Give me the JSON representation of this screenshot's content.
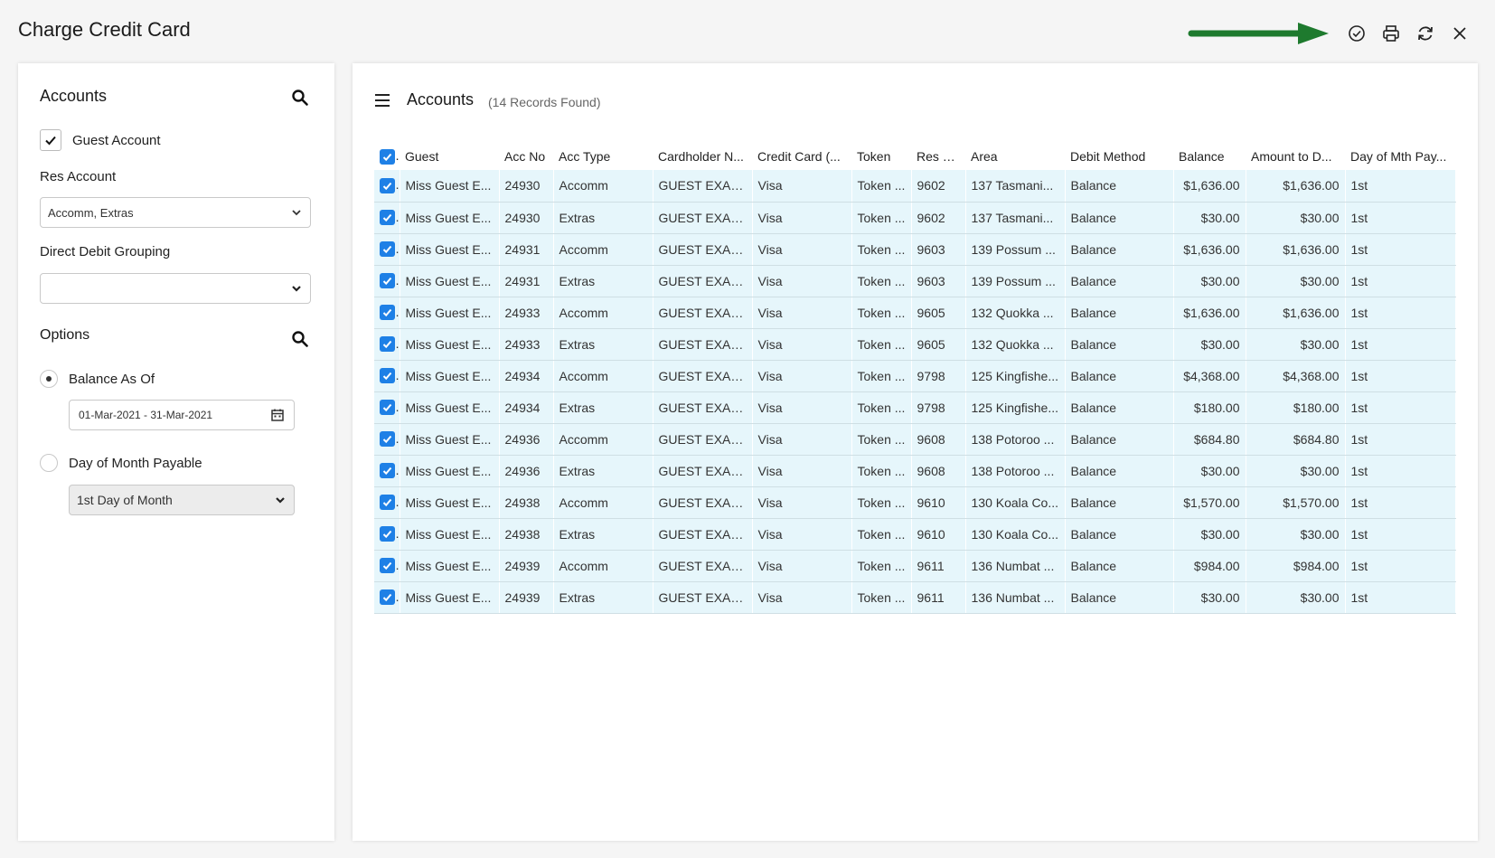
{
  "window": {
    "title": "Charge Credit Card"
  },
  "toolbar": {
    "icons": [
      "check-circle-icon",
      "print-icon",
      "refresh-icon",
      "close-icon"
    ],
    "arrow_color": "#1e7a2e"
  },
  "left": {
    "accounts_heading": "Accounts",
    "guest_account_label": "Guest Account",
    "guest_account_checked": true,
    "res_account_label": "Res Account",
    "res_account_value": "Accomm, Extras",
    "direct_debit_label": "Direct Debit Grouping",
    "direct_debit_value": "",
    "options_heading": "Options",
    "balance_as_of_label": "Balance As Of",
    "balance_as_of_selected": true,
    "date_range": "01-Mar-2021 - 31-Mar-2021",
    "day_of_month_label": "Day of Month Payable",
    "day_of_month_value": "1st Day of Month"
  },
  "grid": {
    "title": "Accounts",
    "records_text": "(14 Records Found)",
    "columns": [
      "Guest",
      "Acc No",
      "Acc Type",
      "Cardholder N...",
      "Credit Card (...",
      "Token",
      "Res N...",
      "Area",
      "Debit Method",
      "Balance",
      "Amount to D...",
      "Day of Mth Pay..."
    ],
    "rows": [
      [
        "Miss Guest E...",
        "24930",
        "Accomm",
        "GUEST EXAM...",
        "Visa",
        "Token ...",
        "9602",
        "137 Tasmani...",
        "Balance",
        "$1,636.00",
        "$1,636.00",
        "1st"
      ],
      [
        "Miss Guest E...",
        "24930",
        "Extras",
        "GUEST EXAM...",
        "Visa",
        "Token ...",
        "9602",
        "137 Tasmani...",
        "Balance",
        "$30.00",
        "$30.00",
        "1st"
      ],
      [
        "Miss Guest E...",
        "24931",
        "Accomm",
        "GUEST EXAM...",
        "Visa",
        "Token ...",
        "9603",
        "139 Possum ...",
        "Balance",
        "$1,636.00",
        "$1,636.00",
        "1st"
      ],
      [
        "Miss Guest E...",
        "24931",
        "Extras",
        "GUEST EXAM...",
        "Visa",
        "Token ...",
        "9603",
        "139 Possum ...",
        "Balance",
        "$30.00",
        "$30.00",
        "1st"
      ],
      [
        "Miss Guest E...",
        "24933",
        "Accomm",
        "GUEST EXAM...",
        "Visa",
        "Token ...",
        "9605",
        "132 Quokka ...",
        "Balance",
        "$1,636.00",
        "$1,636.00",
        "1st"
      ],
      [
        "Miss Guest E...",
        "24933",
        "Extras",
        "GUEST EXAM...",
        "Visa",
        "Token ...",
        "9605",
        "132 Quokka ...",
        "Balance",
        "$30.00",
        "$30.00",
        "1st"
      ],
      [
        "Miss Guest E...",
        "24934",
        "Accomm",
        "GUEST EXAM...",
        "Visa",
        "Token ...",
        "9798",
        "125 Kingfishe...",
        "Balance",
        "$4,368.00",
        "$4,368.00",
        "1st"
      ],
      [
        "Miss Guest E...",
        "24934",
        "Extras",
        "GUEST EXAM...",
        "Visa",
        "Token ...",
        "9798",
        "125 Kingfishe...",
        "Balance",
        "$180.00",
        "$180.00",
        "1st"
      ],
      [
        "Miss Guest E...",
        "24936",
        "Accomm",
        "GUEST EXAM...",
        "Visa",
        "Token ...",
        "9608",
        "138 Potoroo ...",
        "Balance",
        "$684.80",
        "$684.80",
        "1st"
      ],
      [
        "Miss Guest E...",
        "24936",
        "Extras",
        "GUEST EXAM...",
        "Visa",
        "Token ...",
        "9608",
        "138 Potoroo ...",
        "Balance",
        "$30.00",
        "$30.00",
        "1st"
      ],
      [
        "Miss Guest E...",
        "24938",
        "Accomm",
        "GUEST EXAM...",
        "Visa",
        "Token ...",
        "9610",
        "130 Koala Co...",
        "Balance",
        "$1,570.00",
        "$1,570.00",
        "1st"
      ],
      [
        "Miss Guest E...",
        "24938",
        "Extras",
        "GUEST EXAM...",
        "Visa",
        "Token ...",
        "9610",
        "130 Koala Co...",
        "Balance",
        "$30.00",
        "$30.00",
        "1st"
      ],
      [
        "Miss Guest E...",
        "24939",
        "Accomm",
        "GUEST EXAM...",
        "Visa",
        "Token ...",
        "9611",
        "136 Numbat ...",
        "Balance",
        "$984.00",
        "$984.00",
        "1st"
      ],
      [
        "Miss Guest E...",
        "24939",
        "Extras",
        "GUEST EXAM...",
        "Visa",
        "Token ...",
        "9611",
        "136 Numbat ...",
        "Balance",
        "$30.00",
        "$30.00",
        "1st"
      ]
    ]
  }
}
